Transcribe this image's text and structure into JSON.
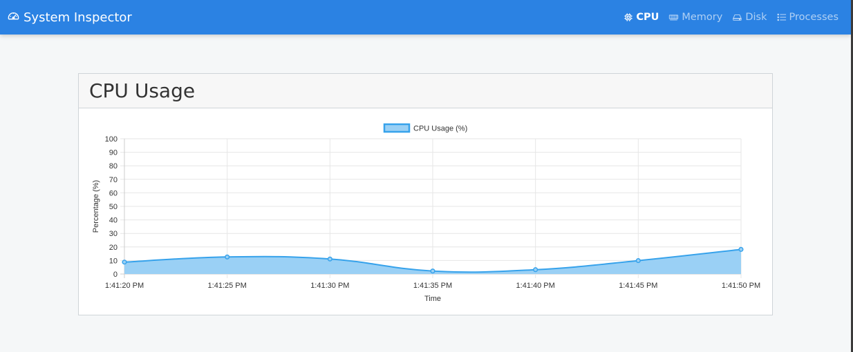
{
  "app": {
    "title": "System Inspector",
    "icon": "speedometer-icon"
  },
  "nav": {
    "items": [
      {
        "label": "CPU",
        "icon": "cpu-icon",
        "active": true
      },
      {
        "label": "Memory",
        "icon": "memory-icon",
        "active": false
      },
      {
        "label": "Disk",
        "icon": "disk-icon",
        "active": false
      },
      {
        "label": "Processes",
        "icon": "list-icon",
        "active": false
      }
    ]
  },
  "card": {
    "title": "CPU Usage"
  },
  "colors": {
    "navbar": "#2b82e3",
    "line": "#36a2eb",
    "fill": "#9ad0f5"
  },
  "chart_data": {
    "type": "area",
    "x": [
      "1:41:20 PM",
      "1:41:25 PM",
      "1:41:30 PM",
      "1:41:35 PM",
      "1:41:40 PM",
      "1:41:45 PM",
      "1:41:50 PM"
    ],
    "series": [
      {
        "name": "CPU Usage (%)",
        "values": [
          8.8,
          12.6,
          11.1,
          2.2,
          3.2,
          9.9,
          18.2
        ]
      }
    ],
    "xlabel": "Time",
    "ylabel": "Percentage (%)",
    "ylim": [
      0,
      100
    ],
    "yticks": [
      0,
      10,
      20,
      30,
      40,
      50,
      60,
      70,
      80,
      90,
      100
    ],
    "grid": true,
    "legend": "top-center"
  }
}
